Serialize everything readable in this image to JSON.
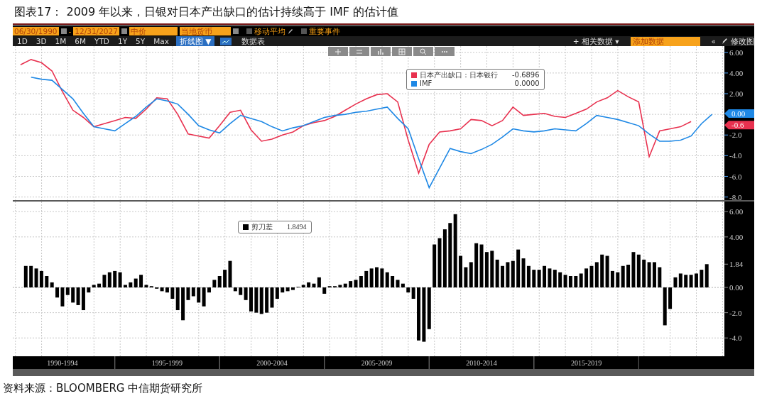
{
  "figure_title": "图表17： 2009 年以来，日银对日本产出缺口的估计持续高于 IMF 的估计值",
  "toolbar": {
    "start_date": "06/30/1990",
    "date_separator": "-",
    "end_date": "12/31/2027",
    "price_field": "中价",
    "currency": "当地货币",
    "checkboxes": [
      {
        "label": "移动平均",
        "checked": false
      },
      {
        "label": "重要事件",
        "checked": false
      }
    ],
    "periods": [
      "1D",
      "3D",
      "1M",
      "6M",
      "YTD",
      "1Y",
      "5Y",
      "Max"
    ],
    "chart_type": "折线图",
    "chart_type_caret": "▼",
    "data_table": "数据表",
    "related_plus": "+",
    "related": "相关数据",
    "related_caret": "▾",
    "add_data_placeholder": "添加数据",
    "collapse": "«",
    "edit": "修改图"
  },
  "top_chart": {
    "legend_values": [
      "-0.6896",
      "0.0000"
    ],
    "last_value_tags": [
      "0.00",
      "-0.6"
    ],
    "chart_data": {
      "type": "line",
      "grid": true,
      "categories": [
        null,
        null,
        null,
        null,
        null,
        null,
        null,
        null,
        null,
        null,
        null,
        null,
        null,
        null,
        null,
        null,
        null,
        null,
        null,
        null,
        null,
        null,
        null,
        null,
        null,
        null,
        null,
        null,
        null,
        null,
        null,
        null,
        null,
        null,
        null,
        null,
        null,
        null,
        null,
        null,
        null,
        null,
        null,
        null,
        null,
        null,
        null,
        null,
        null,
        null,
        null,
        null,
        null,
        null,
        null,
        null,
        null,
        null,
        null,
        null,
        null,
        null,
        null,
        null,
        null,
        null,
        null
      ],
      "series": [
        {
          "name": "日本产出缺口：日本银行",
          "color": "#e8314f",
          "values": [
            4.8,
            5.3,
            5.0,
            4.2,
            2.2,
            0.4,
            -0.3,
            -1.2,
            -0.9,
            -0.6,
            -0.3,
            -0.4,
            0.5,
            1.6,
            1.5,
            0.0,
            -1.9,
            -2.1,
            -2.3,
            -1.1,
            0.2,
            0.4,
            -1.5,
            -2.6,
            -2.4,
            -2.0,
            -1.7,
            -1.1,
            -0.8,
            -0.6,
            -0.2,
            0.4,
            1.0,
            1.5,
            1.9,
            2.0,
            1.2,
            -2.5,
            -5.7,
            -2.9,
            -1.7,
            -1.6,
            -1.4,
            -0.5,
            -0.6,
            -1.1,
            -0.6,
            0.7,
            -0.1,
            0.0,
            0.1,
            -0.2,
            -0.3,
            0.1,
            0.5,
            1.2,
            1.6,
            2.3,
            1.7,
            1.2,
            -4.1,
            -1.6,
            -1.4,
            -1.2,
            -0.69,
            null,
            null
          ]
        },
        {
          "name": "IMF",
          "color": "#1e88e5",
          "values": [
            null,
            3.6,
            3.4,
            3.3,
            2.4,
            1.5,
            0.1,
            -1.2,
            -1.4,
            -1.6,
            -0.9,
            -0.2,
            0.7,
            1.5,
            1.3,
            1.0,
            0.0,
            -1.1,
            -1.5,
            -1.8,
            -0.9,
            -0.1,
            -0.4,
            -0.7,
            -1.2,
            -1.6,
            -1.3,
            -1.1,
            -0.7,
            -0.3,
            -0.1,
            0.0,
            0.2,
            0.3,
            0.5,
            0.7,
            -0.4,
            -1.4,
            -4.3,
            -7.1,
            -5.2,
            -3.3,
            -3.6,
            -3.8,
            -3.4,
            -2.9,
            -2.2,
            -1.4,
            -1.6,
            -1.7,
            -1.6,
            -1.4,
            -1.5,
            -1.6,
            -0.9,
            -0.1,
            -0.3,
            -0.5,
            -0.8,
            -1.1,
            -1.9,
            -2.6,
            -2.6,
            -2.5,
            -2.1,
            -0.9,
            0.0
          ]
        }
      ],
      "ylim": [
        -8.3,
        6.6
      ],
      "yticks": [
        {
          "value": 6,
          "label": "6.00"
        },
        {
          "value": 4,
          "label": "4.00"
        },
        {
          "value": 2,
          "label": "2.00"
        },
        {
          "value": -2,
          "label": "-2.0"
        },
        {
          "value": -4,
          "label": "-4.0"
        },
        {
          "value": -6,
          "label": "-6.0"
        },
        {
          "value": -8,
          "label": "-8.0"
        }
      ]
    }
  },
  "bottom_chart": {
    "legend_values": [
      "1.8494"
    ],
    "last_value_label": "1.84",
    "chart_data": {
      "type": "bar",
      "grid": true,
      "categories": [
        null,
        null,
        null,
        null,
        null,
        null,
        null,
        "1990-1994",
        null,
        null,
        null,
        null,
        null,
        null,
        null,
        null,
        null,
        null,
        null,
        null,
        null,
        null,
        null,
        null,
        null,
        null,
        null,
        "1995-1999",
        null,
        null,
        null,
        null,
        null,
        null,
        null,
        null,
        null,
        null,
        null,
        null,
        null,
        null,
        null,
        null,
        null,
        null,
        null,
        "2000-2004",
        null,
        null,
        null,
        null,
        null,
        null,
        null,
        null,
        null,
        null,
        null,
        null,
        null,
        null,
        null,
        null,
        null,
        null,
        null,
        "2005-2009",
        null,
        null,
        null,
        null,
        null,
        null,
        null,
        null,
        null,
        null,
        null,
        null,
        null,
        null,
        null,
        null,
        null,
        null,
        null,
        "2010-2014",
        null,
        null,
        null,
        null,
        null,
        null,
        null,
        null,
        null,
        null,
        null,
        null,
        null,
        null,
        null,
        null,
        null,
        null,
        null,
        "2015-2019",
        null,
        null,
        null,
        null,
        null,
        null,
        null,
        null,
        null,
        null,
        null,
        null,
        null,
        null,
        null,
        null,
        null,
        null,
        null,
        null,
        null,
        null,
        null
      ],
      "series": [
        {
          "name": "剪刀差",
          "color": "#000000",
          "values": [
            1.7,
            1.7,
            1.5,
            1.3,
            0.9,
            0.4,
            -0.8,
            -1.5,
            -0.6,
            -1.2,
            -1.4,
            -1.8,
            -0.4,
            0.2,
            0.3,
            1.0,
            1.2,
            1.3,
            1.2,
            0.2,
            0.4,
            0.7,
            1.0,
            0.2,
            0.1,
            -0.1,
            -0.3,
            -0.4,
            -0.9,
            -1.8,
            -2.6,
            -1.0,
            -0.7,
            -1.2,
            -1.5,
            -0.4,
            0.6,
            0.9,
            1.4,
            2.1,
            -0.3,
            -0.6,
            -1.0,
            -1.9,
            -2.0,
            -2.1,
            -2.0,
            -1.6,
            -0.9,
            -0.4,
            -0.3,
            -0.2,
            0.05,
            0.2,
            0.4,
            0.3,
            0.8,
            -0.5,
            0.1,
            0.1,
            0.2,
            0.3,
            0.5,
            0.6,
            0.9,
            1.3,
            1.5,
            1.6,
            1.5,
            1.2,
            0.9,
            0.6,
            0.3,
            -0.4,
            -0.9,
            -4.2,
            -4.3,
            -3.3,
            3.4,
            3.9,
            4.6,
            5.1,
            5.8,
            2.5,
            1.6,
            2.0,
            3.5,
            3.4,
            2.8,
            2.9,
            2.2,
            1.7,
            2.0,
            2.1,
            3.0,
            2.3,
            1.7,
            1.4,
            1.4,
            1.7,
            1.5,
            1.4,
            1.2,
            1.0,
            0.9,
            0.9,
            1.1,
            1.5,
            1.7,
            2.0,
            2.6,
            2.5,
            1.3,
            1.2,
            1.7,
            1.8,
            2.8,
            2.6,
            2.2,
            2.0,
            2.0,
            1.6,
            -3.0,
            -1.7,
            0.8,
            1.1,
            1.0,
            1.0,
            1.1,
            1.4,
            1.84
          ]
        }
      ],
      "ylim": [
        -5.45,
        6.8
      ],
      "yticks": [
        {
          "value": 6,
          "label": "6.00"
        },
        {
          "value": 4,
          "label": "4.00"
        },
        {
          "value": 0,
          "label": "0.00"
        },
        {
          "value": -2,
          "label": "-2.0"
        },
        {
          "value": -4,
          "label": "-4.0"
        }
      ]
    }
  },
  "source_note": "资料来源：BLOOMBERG   中信期货研究所"
}
